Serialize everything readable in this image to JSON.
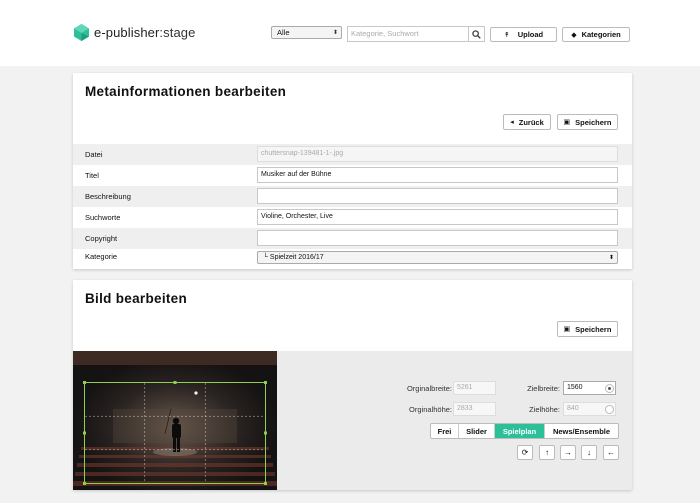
{
  "header": {
    "logo_name": "e-publisher",
    "logo_suffix": ":stage",
    "category_select": "Alle",
    "search_placeholder": "Kategorie, Suchwort",
    "upload_label": "Upload",
    "categories_label": "Kategorien"
  },
  "meta_panel": {
    "title": "Metainformationen bearbeiten",
    "back_label": "Zurück",
    "save_label": "Speichern",
    "rows": [
      {
        "label": "Datei",
        "value": "chuttersnap-139481-1-.jpg"
      },
      {
        "label": "Titel",
        "value": "Musiker auf der Bühne"
      },
      {
        "label": "Beschreibung",
        "value": ""
      },
      {
        "label": "Suchworte",
        "value": "Violine, Orchester, Live"
      },
      {
        "label": "Copyright",
        "value": ""
      },
      {
        "label": "Kategorie",
        "value": "└ Spielzeit 2016/17"
      }
    ]
  },
  "image_panel": {
    "title": "Bild bearbeiten",
    "save_label": "Speichern",
    "original_width_label": "Orginalbreite:",
    "original_width": "5261",
    "original_height_label": "Orginalhöhe:",
    "original_height": "2833",
    "target_width_label": "Zielbreite:",
    "target_width": "1560",
    "target_height_label": "Zielhöhe:",
    "target_height": "840",
    "presets": [
      "Frei",
      "Slider",
      "Spielplan",
      "News/Ensemble"
    ],
    "active_preset": "Spielplan"
  },
  "colors": {
    "accent": "#2bbf9a",
    "crop_frame": "#8fd14f"
  },
  "icons": {
    "logo": "logo-mark-icon",
    "search": "search-icon",
    "upload": "upload-icon",
    "tag": "tag-icon",
    "back": "chevron-left-icon",
    "save": "floppy-disk-icon",
    "rotate": "rotate-icon",
    "up": "arrow-up-icon",
    "right": "arrow-right-icon",
    "down": "arrow-down-icon",
    "left": "arrow-left-icon"
  }
}
